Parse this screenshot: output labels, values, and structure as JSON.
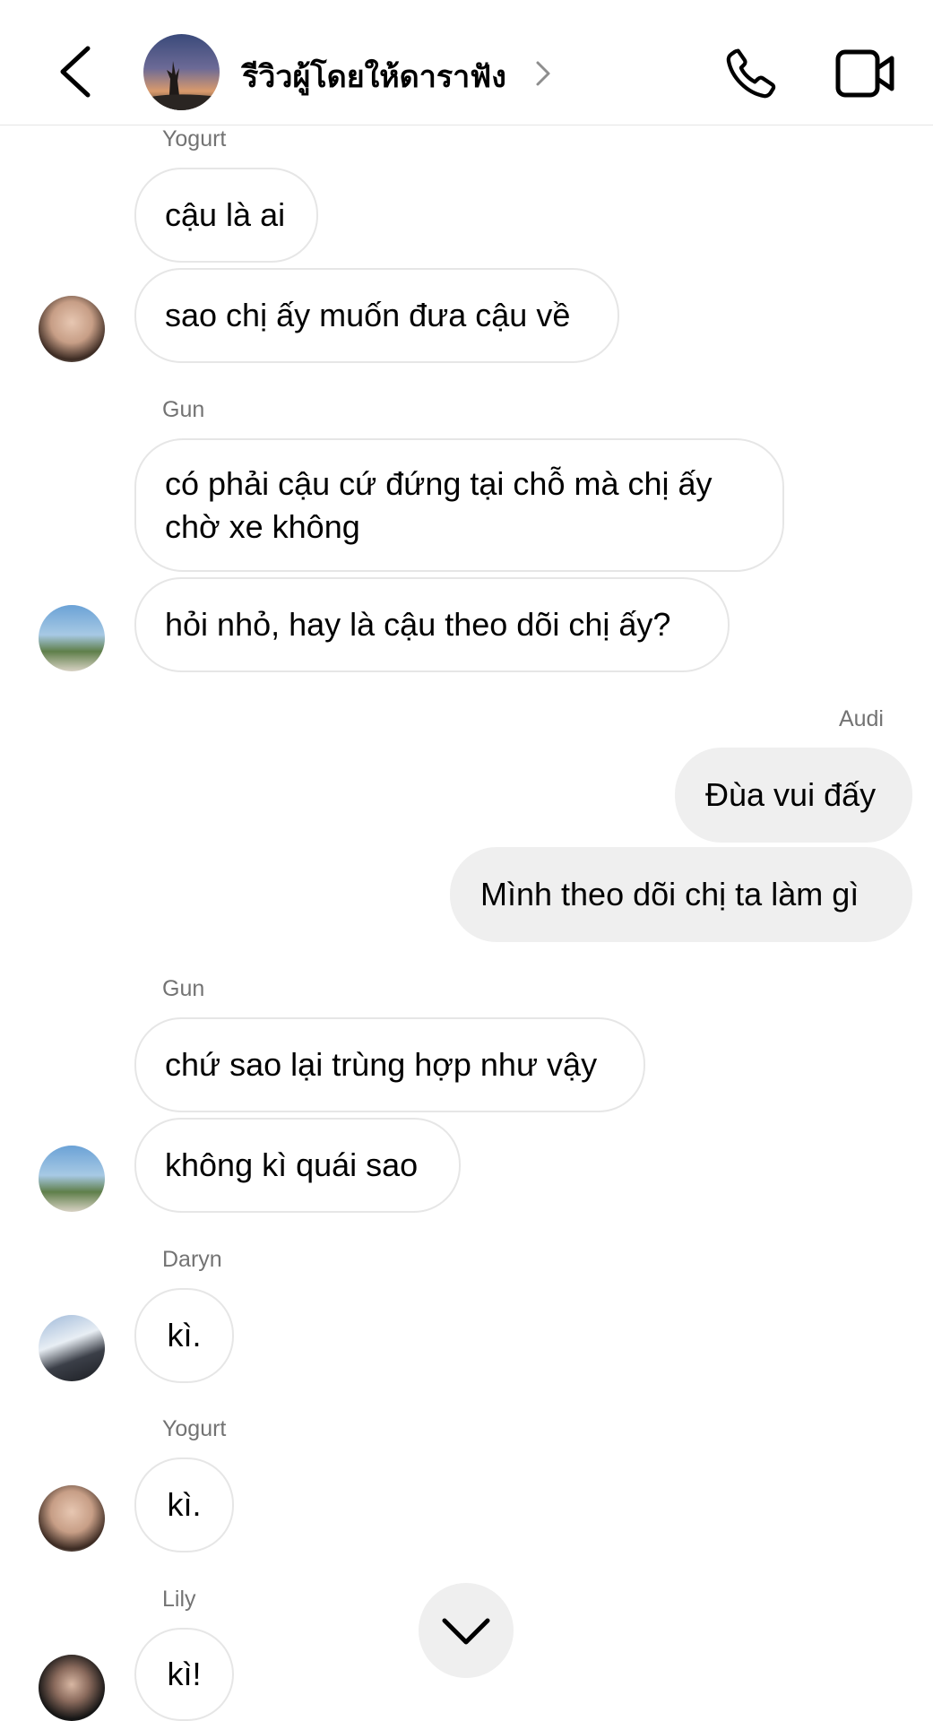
{
  "header": {
    "group_name": "รีวิวผู้โดยให้ดาราฟัง",
    "icons": {
      "back": "chevron-left-icon",
      "chevron": "chevron-right-icon",
      "call": "phone-icon",
      "video": "video-camera-icon"
    }
  },
  "messages": [
    {
      "sender": "Yogurt",
      "bubbles": [
        "cậu là ai",
        "sao chị ấy muốn đưa cậu về"
      ]
    },
    {
      "sender": "Gun",
      "bubbles": [
        "có phải cậu cứ đứng tại chỗ mà chị ấy chờ xe không",
        "hỏi nhỏ, hay là cậu theo dõi chị ấy?"
      ]
    },
    {
      "sender": "Audi",
      "bubbles": [
        "Đùa vui đấy",
        "Mình theo dõi chị ta làm gì"
      ]
    },
    {
      "sender": "Gun",
      "bubbles": [
        "chứ sao lại trùng hợp như vậy",
        "không kì quái sao"
      ]
    },
    {
      "sender": "Daryn",
      "bubbles": [
        "kì."
      ]
    },
    {
      "sender": "Yogurt",
      "bubbles": [
        "kì."
      ]
    },
    {
      "sender": "Lily",
      "bubbles": [
        "kì!"
      ]
    }
  ],
  "controls": {
    "scroll_down_icon": "chevron-down-icon"
  },
  "colors": {
    "own_bubble": "#efefef",
    "bubble_border": "#e6e6e6",
    "sender_name": "#737373"
  }
}
